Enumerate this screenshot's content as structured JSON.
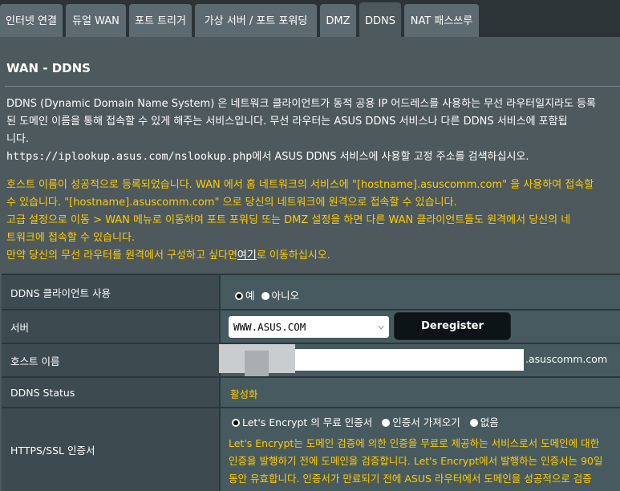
{
  "tabs": [
    {
      "label": "인터넷 연결",
      "active": false
    },
    {
      "label": "듀얼 WAN",
      "active": false
    },
    {
      "label": "포트 트리거",
      "active": false
    },
    {
      "label": "가상 서버 / 포트 포워딩",
      "active": false
    },
    {
      "label": "DMZ",
      "active": false
    },
    {
      "label": "DDNS",
      "active": true
    },
    {
      "label": "NAT 패스쓰루",
      "active": false
    }
  ],
  "page_title": "WAN - DDNS",
  "description": {
    "line1": "DDNS (Dynamic Domain Name System) 은 네트워크 클라이언트가 동적 공용 IP 어드레스를 사용하는 무선 라우터일지라도 등록",
    "line2": "된 도메인 이름을 통해 접속할 수 있게 해주는 서비스입니다. 무선 라우터는 ASUS DDNS 서비스나 다른 DDNS 서비스에 포함됩",
    "line3": "니다.",
    "lookup_url": "https://iplookup.asus.com/nslookup.php",
    "lookup_suffix": "에서 ASUS DDNS 서비스에 사용할 고정 주소를 검색하십시오."
  },
  "notice": {
    "line1": "호스트 이름이 성공적으로 등록되었습니다. WAN 에서 홈 네트워크의 서비스에 \"[hostname].asuscomm.com\" 을 사용하여 접속할",
    "line2": "수 있습니다. \"[hostname].asuscomm.com\" 으로 당신의 네트워크에 원격으로 접속할 수 있습니다.",
    "line3": "고급 설정으로 이동 > WAN 메뉴로 이동하여 포트 포워딩 또는 DMZ 설정을 하면 다른 WAN 클라이언트들도 원격에서 당신의 네",
    "line4": "트워크에 접속할 수 있습니다.",
    "line5_prefix": "만약 당신의 무선 라우터를 원격에서 구성하고 싶다면",
    "line5_link": "여기",
    "line5_suffix": "로 이동하십시오."
  },
  "settings": {
    "enable_ddns": {
      "label": "DDNS 클라이언트 사용",
      "options": [
        {
          "label": "예",
          "selected": true
        },
        {
          "label": "아니오",
          "selected": false
        }
      ]
    },
    "server": {
      "label": "서버",
      "selected": "WWW.ASUS.COM",
      "button": "Deregister"
    },
    "hostname": {
      "label": "호스트 이름",
      "value": "",
      "suffix": ".asuscomm.com"
    },
    "status": {
      "label": "DDNS Status",
      "value": "활성화"
    },
    "https_cert": {
      "label": "HTTPS/SSL 인증서",
      "options": [
        {
          "label": "Let's Encrypt 의 무료 인증서",
          "selected": true
        },
        {
          "label": "인증서 가져오기",
          "selected": false
        },
        {
          "label": "없음",
          "selected": false
        }
      ],
      "desc_line1": "Let's Encrypt는 도메인 검증에 의한 인증을 무료로 제공하는 서비스로서 도메인에 대한",
      "desc_line2": "인증을 발행하기 전에 도메인을 검증합니다. Let's Encrypt에서 발행하는 인증서는 90일",
      "desc_line3": "동안 유효합니다. 인증서가 만료되기 전에 ASUS 라우터에서 도메인을 성공적으로 검증"
    }
  },
  "colors": {
    "background": "#4d595d",
    "tab_bar": "#2c3437",
    "tab": "#5d6a6f",
    "label_cell": "#3d4a4f",
    "value_cell": "#475a5f",
    "notice_text": "#ffcc00",
    "button": "#0d1417"
  }
}
